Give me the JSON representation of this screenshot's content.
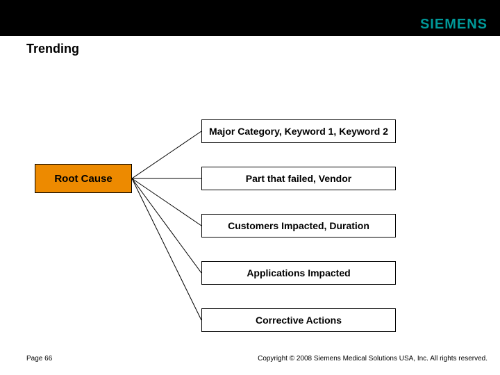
{
  "brand": {
    "logo_text": "SIEMENS"
  },
  "header": {
    "title": "Trending"
  },
  "diagram": {
    "root_label": "Root Cause",
    "branches": [
      {
        "label": "Major Category, Keyword 1, Keyword 2"
      },
      {
        "label": "Part that failed, Vendor"
      },
      {
        "label": "Customers Impacted, Duration"
      },
      {
        "label": "Applications Impacted"
      },
      {
        "label": "Corrective Actions"
      }
    ]
  },
  "footer": {
    "page_label": "Page 66",
    "copyright": "Copyright © 2008 Siemens Medical Solutions USA, Inc. All rights reserved."
  }
}
